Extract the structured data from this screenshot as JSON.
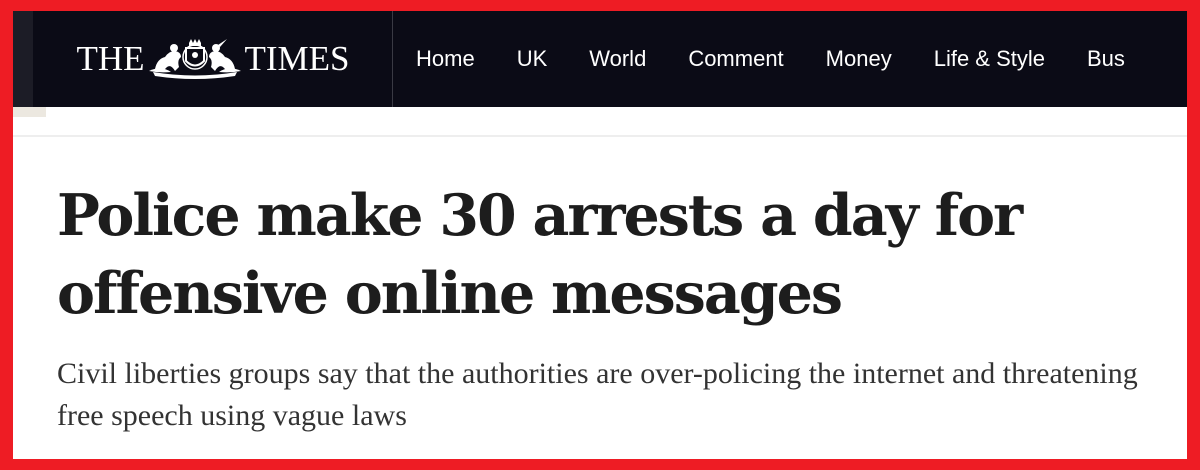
{
  "masthead": {
    "left_word": "THE",
    "right_word": "TIMES",
    "crest_icon": "royal-coat-of-arms"
  },
  "nav": {
    "items": [
      {
        "label": "Home"
      },
      {
        "label": "UK"
      },
      {
        "label": "World"
      },
      {
        "label": "Comment"
      },
      {
        "label": "Money"
      },
      {
        "label": "Life & Style"
      },
      {
        "label": "Bus"
      }
    ]
  },
  "article": {
    "headline": "Police make 30 arrests a day for offensive online messages",
    "standfirst": "Civil liberties groups say that the authorities are over-policing the internet and threatening free speech using vague laws"
  },
  "colors": {
    "border": "#ee1c24",
    "navbar": "#0b0b16",
    "headline": "#1d1d1d",
    "standfirst": "#333333"
  }
}
